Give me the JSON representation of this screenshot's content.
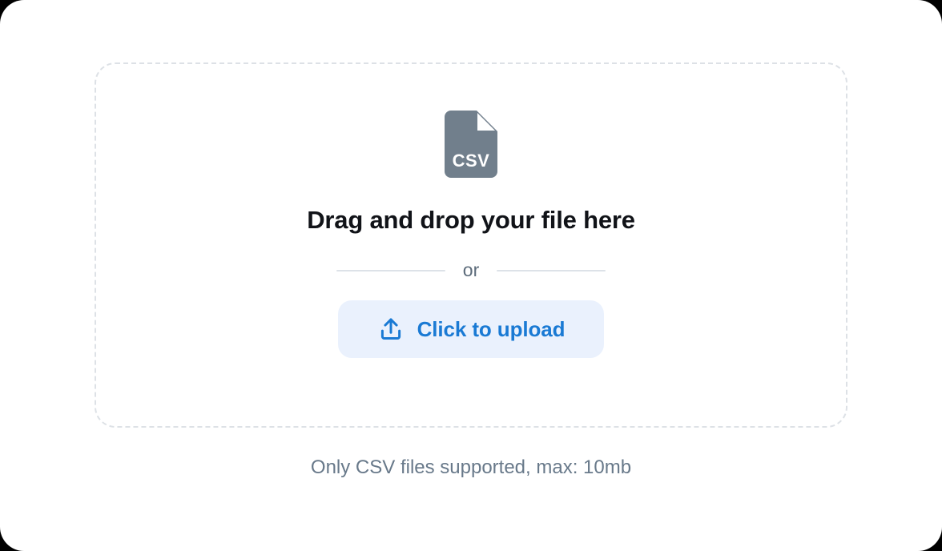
{
  "card": {
    "background_color": "#ffffff",
    "corner_radius": "30px"
  },
  "dropzone": {
    "name": "csv-file-dropzone",
    "border_color": "#dde1e6",
    "border_style": "dashed",
    "file_icon": {
      "icon_name": "csv-file-icon",
      "label": "CSV",
      "fill_color": "#717f8c",
      "text_color": "#ffffff"
    },
    "headline": "Drag and drop your file here",
    "headline_color": "#111318",
    "divider": {
      "label": "or",
      "label_color": "#5d6c7b",
      "line_color": "#dde2e8"
    },
    "upload_button": {
      "label": "Click to upload",
      "icon_name": "upload-icon",
      "background_color": "#eaf1fd",
      "text_color": "#1a7ad4"
    }
  },
  "hint": {
    "text": "Only CSV files supported, max: 10mb",
    "color": "#68798a"
  }
}
